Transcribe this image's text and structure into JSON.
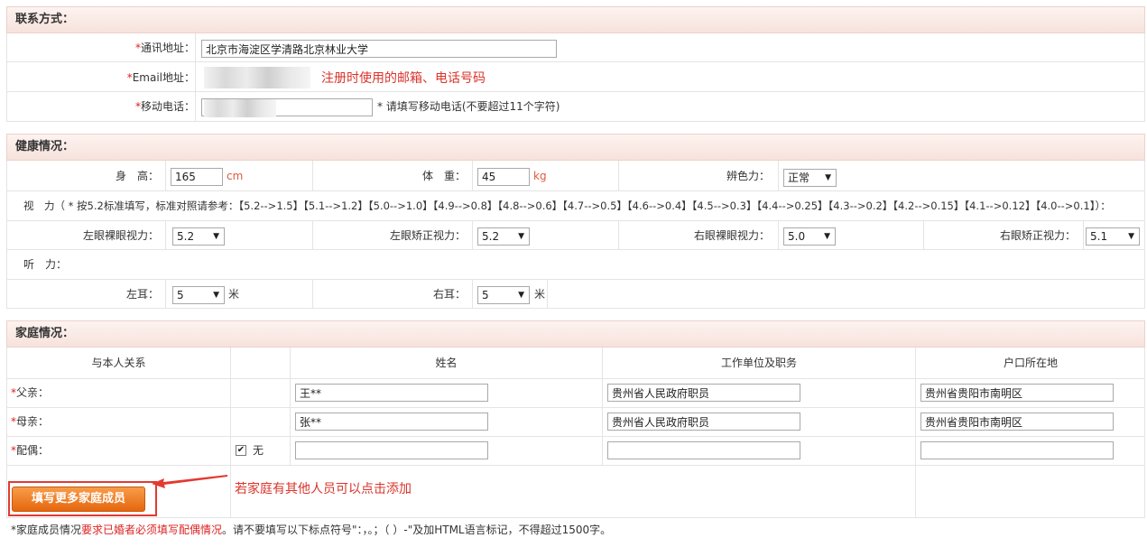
{
  "contact": {
    "title": "联系方式：",
    "address": {
      "label": "通讯地址：",
      "value": "北京市海淀区学清路北京林业大学"
    },
    "email": {
      "label": "Email地址："
    },
    "mobile": {
      "label": "移动电话：",
      "hint": "* 请填写移动电话(不要超过11个字符)"
    },
    "annotation": "注册时使用的邮箱、电话号码"
  },
  "health": {
    "title": "健康情况：",
    "height": {
      "label": "身　高：",
      "value": "165",
      "unit": "cm"
    },
    "weight": {
      "label": "体　重：",
      "value": "45",
      "unit": "kg"
    },
    "color_vision": {
      "label": "辨色力：",
      "value": "正常"
    },
    "vision_note": "视　力（ * 按5.2标准填写，标准对照请参考：【5.2-->1.5】【5.1-->1.2】【5.0-->1.0】【4.9-->0.8】【4.8-->0.6】【4.7-->0.5】【4.6-->0.4】【4.5-->0.3】【4.4-->0.25】【4.3-->0.2】【4.2-->0.15】【4.1-->0.12】【4.0-->0.1】）：",
    "left_naked": {
      "label": "左眼裸眼视力：",
      "value": "5.2"
    },
    "left_corrected": {
      "label": "左眼矫正视力：",
      "value": "5.2"
    },
    "right_naked": {
      "label": "右眼裸眼视力：",
      "value": "5.0"
    },
    "right_corrected": {
      "label": "右眼矫正视力：",
      "value": "5.1"
    },
    "hearing_label": "听　力：",
    "left_ear": {
      "label": "左耳：",
      "value": "5",
      "unit": "米"
    },
    "right_ear": {
      "label": "右耳：",
      "value": "5",
      "unit": "米"
    }
  },
  "family": {
    "title": "家庭情况：",
    "columns": [
      "与本人关系",
      "姓名",
      "工作单位及职务",
      "户口所在地"
    ],
    "rows": [
      {
        "relation": "父亲：",
        "name": "王**",
        "work": "贵州省人民政府职员",
        "hukou": "贵州省贵阳市南明区"
      },
      {
        "relation": "母亲：",
        "name": "张**",
        "work": "贵州省人民政府职员",
        "hukou": "贵州省贵阳市南明区"
      },
      {
        "relation": "配偶：",
        "none_label": "无",
        "none_checked": "✔",
        "name": "",
        "work": "",
        "hukou": ""
      }
    ],
    "add_button": "填写更多家庭成员",
    "annotation": "若家庭有其他人员可以点击添加",
    "footnote_pre": "*家庭成员情况",
    "footnote_red": "要求已婚者必须填写配偶情况",
    "footnote_post": "。请不要填写以下标点符号\"：，。；（ ）-\"及加HTML语言标记，不得超过1500字。"
  },
  "required_mark": "*",
  "colors": {
    "accent": "#e6670e",
    "annotation": "#d9342b",
    "required": "#dd2222"
  }
}
